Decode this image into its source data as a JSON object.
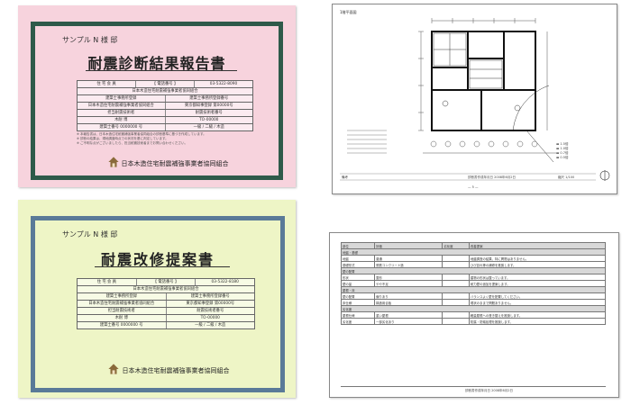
{
  "diagnosis_report": {
    "sample_label": "サンプル N 様 邸",
    "title": "耐震診断結果報告書",
    "rows": [
      [
        "住 宅 会 員",
        "【 電話番号 】",
        "03-5322-8090"
      ],
      [
        "日本木造住宅耐震補強事業者協同組合"
      ],
      [
        "建築士事務所登録",
        "建築士事務所登録番号"
      ],
      [
        "日本木造住宅耐震補強事業者協同組合",
        "東京都知事登録 第00000号"
      ],
      [
        "担当耐震技術者",
        "耐震技術者番号"
      ],
      [
        "木耐 博",
        "TO-00000"
      ],
      [
        "建築士番号 0000000 号",
        "一級 / 二級 / 木造"
      ]
    ],
    "notes": [
      "※ 本報告書は、日本木造住宅耐震補強事業者協同組合の診断基準に基づき作成しています。",
      "※ 診断の結果は、現地調査時点での状況を基に判定しています。",
      "※ ご不明な点がございましたら、担当耐震技術者までお問い合わせください。"
    ],
    "association": "日本木造住宅耐震補強事業者協同組合"
  },
  "retrofit_proposal": {
    "sample_label": "サンプル N 様 邸",
    "title": "耐震改修提案書",
    "rows": [
      [
        "住 宅 会 員",
        "【 電話番号 】",
        "03-5322-8180"
      ],
      [
        "日本木造住宅耐震補強事業者協同組合"
      ],
      [
        "建築士事務所登録",
        "建築士事務所登録番号"
      ],
      [
        "日本木造住宅耐震補強事業者協同組合",
        "東京都知事登録 第00000号"
      ],
      [
        "担当耐震技術者",
        "耐震技術者番号"
      ],
      [
        "木耐 博",
        "TO-00000"
      ],
      [
        "建築士番号 0000000 号",
        "一級 / 二級 / 木造"
      ]
    ],
    "association": "日本木造住宅耐震補強事業者協同組合"
  },
  "floor_plan_page": {
    "heading": "1階平面図",
    "page_number": "— 5 —",
    "legend": [
      "1.5倍",
      "1.0倍",
      "0.7倍",
      "0.5倍"
    ],
    "footer": [
      "備考",
      "診断書作成年月日 2008年6月2日",
      "縮尺 1/100"
    ]
  },
  "table_page": {
    "header": [
      "部位",
      "評価",
      "劣化度",
      "改善提案"
    ],
    "sections": [
      "地盤・基礎",
      "壁の配置",
      "屋根・床",
      "劣化度"
    ],
    "rows": [
      [
        "地盤",
        "普通",
        "",
        "地盤調査の結果、特に問題はありません。"
      ],
      [
        "基礎形式",
        "鉄筋コンクリート造",
        "",
        "ひび割れ等の補修を推奨します。"
      ],
      [
        "形状",
        "整形",
        "",
        "建物の形状は整っています。"
      ],
      [
        "壁の量",
        "やや不足",
        "",
        "耐力壁の追加を提案します。"
      ],
      [
        "壁の配置",
        "偏りあり",
        "",
        "バランスよく壁を配置してください。"
      ],
      [
        "床仕様",
        "構造用合板",
        "",
        "現状のままで問題ありません。"
      ],
      [
        "屋根仕様",
        "重い屋根",
        "",
        "軽量屋根への葺き替えを推奨します。"
      ],
      [
        "劣化度",
        "一部劣化あり",
        "",
        "防腐・防蟻処理を推奨します。"
      ]
    ],
    "footer": "診断書作成年月日 2008年6月2日"
  }
}
